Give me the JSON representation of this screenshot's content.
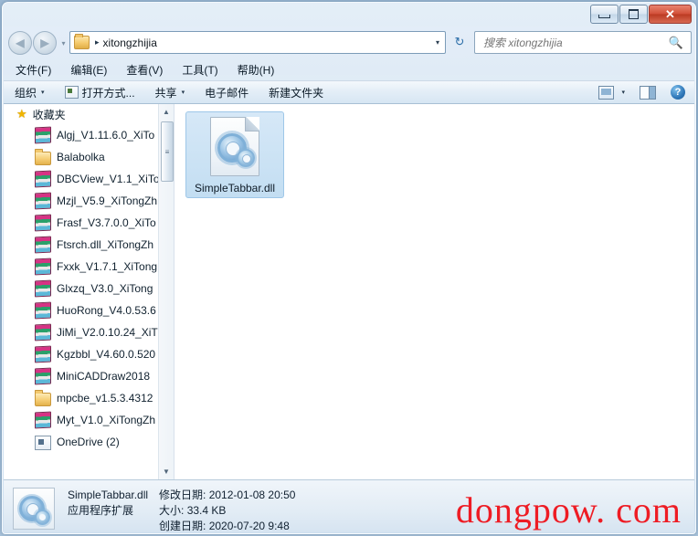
{
  "window": {
    "controls": {
      "minimize": "—",
      "maximize": "□",
      "close": "✕"
    }
  },
  "address_bar": {
    "back_arrow": "◀",
    "forward_arrow": "▶",
    "history_caret": "▾",
    "folder_icon": "folder-icon",
    "separator": "▸",
    "path": "xitongzhijia",
    "dropdown_caret": "▾",
    "refresh_icon": "↻"
  },
  "search": {
    "placeholder": "搜索 xitongzhijia",
    "value": "",
    "icon": "search-icon"
  },
  "menu": {
    "items": [
      {
        "label": "文件(F)",
        "name": "menu-file"
      },
      {
        "label": "编辑(E)",
        "name": "menu-edit"
      },
      {
        "label": "查看(V)",
        "name": "menu-view"
      },
      {
        "label": "工具(T)",
        "name": "menu-tools"
      },
      {
        "label": "帮助(H)",
        "name": "menu-help"
      }
    ]
  },
  "toolbar": {
    "organize": "组织",
    "organize_caret": "▾",
    "open_with": "打开方式...",
    "share": "共享",
    "share_caret": "▾",
    "email": "电子邮件",
    "new_folder": "新建文件夹",
    "view_caret": "▾",
    "help_glyph": "?"
  },
  "sidebar": {
    "header": {
      "label": "收藏夹",
      "icon": "star-icon"
    },
    "items": [
      {
        "label": "Algj_V1.11.6.0_XiTo",
        "icon": "archive"
      },
      {
        "label": "Balabolka",
        "icon": "folder"
      },
      {
        "label": "DBCView_V1.1_XiTo",
        "icon": "archive"
      },
      {
        "label": "Mzjl_V5.9_XiTongZh",
        "icon": "archive"
      },
      {
        "label": "Frasf_V3.7.0.0_XiTo",
        "icon": "archive"
      },
      {
        "label": "Ftsrch.dll_XiTongZh",
        "icon": "archive"
      },
      {
        "label": "Fxxk_V1.7.1_XiTong",
        "icon": "archive"
      },
      {
        "label": "Glxzq_V3.0_XiTong",
        "icon": "archive"
      },
      {
        "label": "HuoRong_V4.0.53.6",
        "icon": "archive"
      },
      {
        "label": "JiMi_V2.0.10.24_XiT",
        "icon": "archive"
      },
      {
        "label": "Kgzbbl_V4.60.0.520",
        "icon": "archive"
      },
      {
        "label": "MiniCADDraw2018",
        "icon": "archive"
      },
      {
        "label": "mpcbe_v1.5.3.4312",
        "icon": "folder"
      },
      {
        "label": "Myt_V1.0_XiTongZh",
        "icon": "archive"
      },
      {
        "label": "OneDrive (2)",
        "icon": "onedrive"
      }
    ],
    "scrollbar": {
      "up_arrow": "▲",
      "down_arrow": "▼",
      "thumb_grip": "≡"
    }
  },
  "files": [
    {
      "name": "SimpleTabbar.dll",
      "icon": "dll-gear-icon",
      "selected": true
    }
  ],
  "details_pane": {
    "icon": "dll-gear-icon",
    "file_name": "SimpleTabbar.dll",
    "file_type": "应用程序扩展",
    "modified_label": "修改日期:",
    "modified_value": "2012-01-08 20:50",
    "size_label": "大小:",
    "size_value": "33.4 KB",
    "created_label": "创建日期:",
    "created_value": "2020-07-20 9:48"
  },
  "watermark": {
    "text": "dongpow. com",
    "color": "#ee1c24"
  }
}
